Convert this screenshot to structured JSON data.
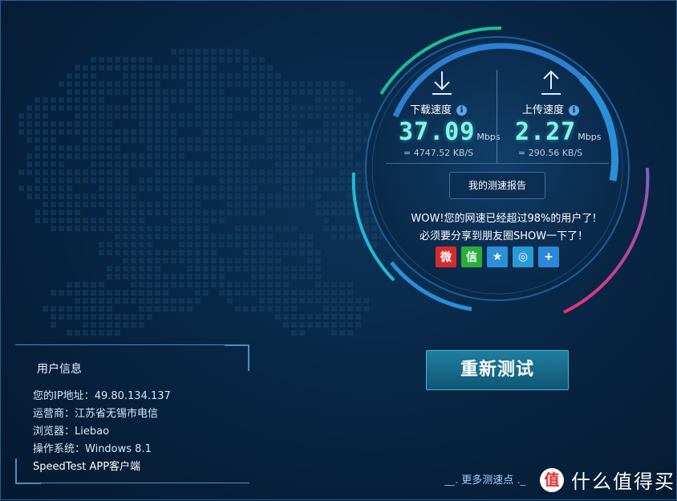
{
  "speed": {
    "download": {
      "label": "下载速度",
      "value": "37.09",
      "unit": "Mbps",
      "kbs_prefix": "=",
      "kbs_value": "4747.52",
      "kbs_unit": "KB/S"
    },
    "upload": {
      "label": "上传速度",
      "value": "2.27",
      "unit": "Mbps",
      "kbs_prefix": "=",
      "kbs_value": "290.56",
      "kbs_unit": "KB/S"
    },
    "info_glyph": "i"
  },
  "report_button": "我的测速报告",
  "share": {
    "line1": "WOW!您的网速已经超过98%的用户了!",
    "line2": "必须要分享到朋友圈SHOW一下了！",
    "icons": [
      {
        "name": "weibo-icon",
        "glyph": "微",
        "color": "#d52c2b"
      },
      {
        "name": "wechat-icon",
        "glyph": "信",
        "color": "#2aae3a"
      },
      {
        "name": "qzone-icon",
        "glyph": "★",
        "color": "#2d8fd8"
      },
      {
        "name": "tencent-weibo-icon",
        "glyph": "◎",
        "color": "#2a9ad6"
      },
      {
        "name": "more-share-icon",
        "glyph": "+",
        "color": "#2b87d8"
      }
    ]
  },
  "retest_button": "重新测试",
  "user_info": {
    "title": "用户信息",
    "ip_label": "您的IP地址：",
    "ip_value": "49.80.134.137",
    "isp_label": "运营商：",
    "isp_value": "江苏省无锡市电信",
    "browser_label": "浏览器：",
    "browser_value": "Liebao",
    "os_label": "操作系统：",
    "os_value": "Windows 8.1",
    "app_link": "SpeedTest APP客户端"
  },
  "more_points": "更多测速点",
  "watermark": {
    "logo": "值",
    "text": "什么值得买"
  },
  "colors": {
    "background": "#051a33",
    "accent_cyan": "#7ff7ea",
    "arc_blue": "#2f8fd6",
    "arc_teal": "#19c6a8",
    "arc_pink": "#e0357a"
  }
}
